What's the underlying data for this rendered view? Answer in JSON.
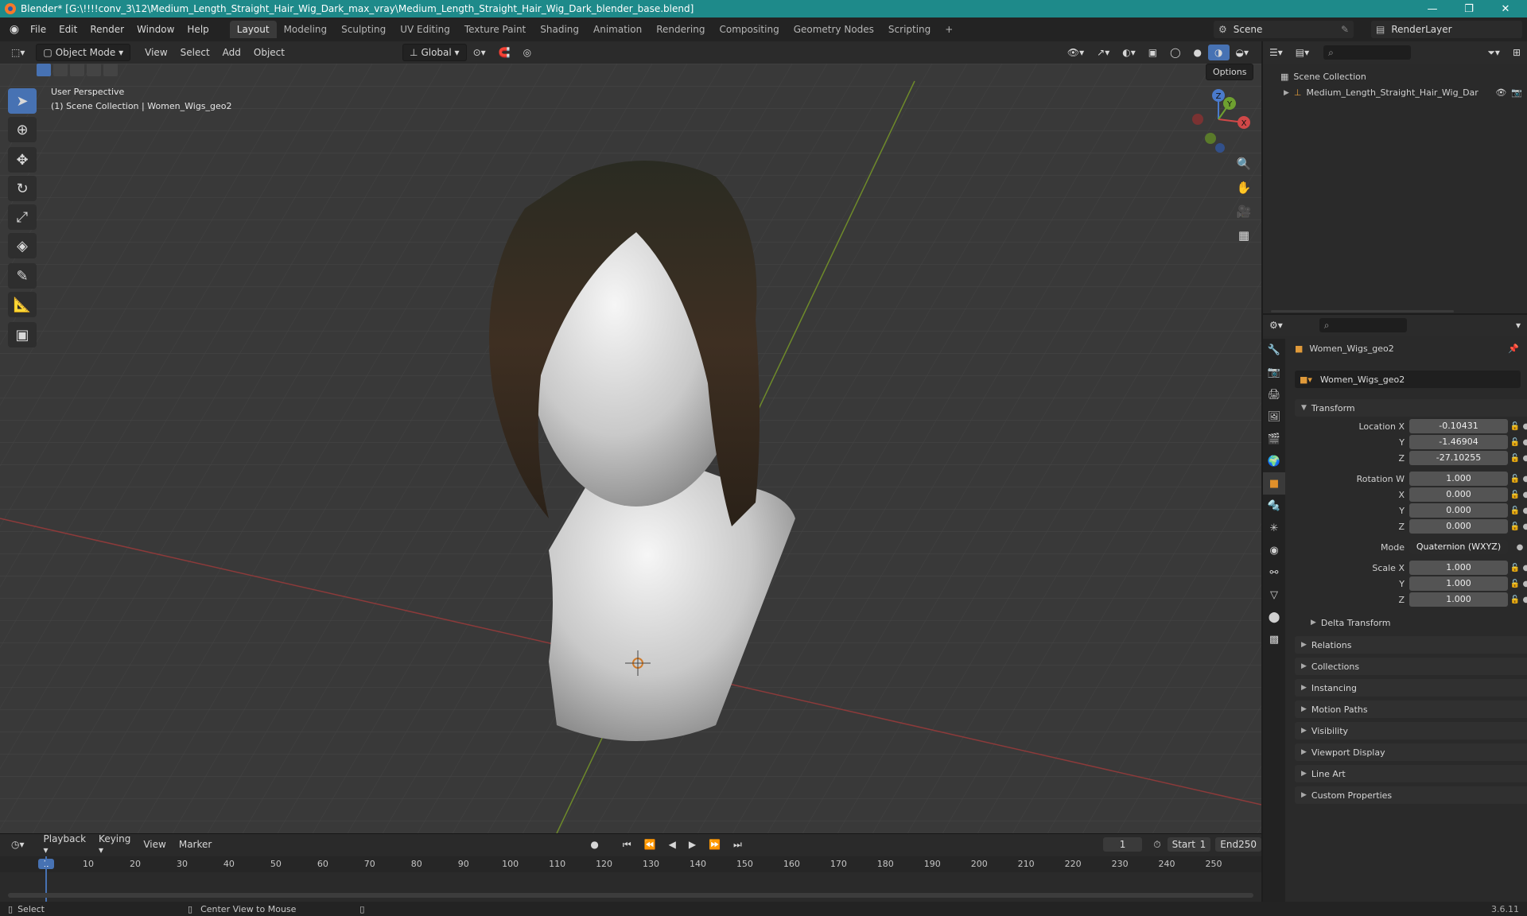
{
  "titlebar": {
    "title": "Blender* [G:\\!!!!conv_3\\12\\Medium_Length_Straight_Hair_Wig_Dark_max_vray\\Medium_Length_Straight_Hair_Wig_Dark_blender_base.blend]",
    "minimize": "—",
    "maximize": "❐",
    "close": "✕"
  },
  "menubar": {
    "menus": [
      "File",
      "Edit",
      "Render",
      "Window",
      "Help"
    ],
    "workspaces": [
      "Layout",
      "Modeling",
      "Sculpting",
      "UV Editing",
      "Texture Paint",
      "Shading",
      "Animation",
      "Rendering",
      "Compositing",
      "Geometry Nodes",
      "Scripting"
    ],
    "add_tab": "+",
    "scene": "Scene",
    "render_layer": "RenderLayer"
  },
  "viewport_header": {
    "mode": "Object Mode",
    "menus": [
      "View",
      "Select",
      "Add",
      "Object"
    ],
    "orientation": "Global",
    "options": "Options"
  },
  "viewport": {
    "perspective": "User Perspective",
    "collection_info": "(1) Scene Collection | Women_Wigs_geo2",
    "gizmo": {
      "x": "X",
      "y": "Y",
      "z": "Z"
    }
  },
  "outliner": {
    "root": "Scene Collection",
    "item": "Medium_Length_Straight_Hair_Wig_Dar"
  },
  "properties": {
    "object_name": "Women_Wigs_geo2",
    "object_field": "Women_Wigs_geo2",
    "transform_title": "Transform",
    "location": {
      "label_x": "Location X",
      "label_y": "Y",
      "label_z": "Z",
      "x": "-0.10431",
      "y": "-1.46904",
      "z": "-27.10255"
    },
    "rotation": {
      "label_w": "Rotation W",
      "label_x": "X",
      "label_y": "Y",
      "label_z": "Z",
      "w": "1.000",
      "x": "0.000",
      "y": "0.000",
      "z": "0.000"
    },
    "mode": {
      "label": "Mode",
      "value": "Quaternion (WXYZ)"
    },
    "scale": {
      "label_x": "Scale X",
      "label_y": "Y",
      "label_z": "Z",
      "x": "1.000",
      "y": "1.000",
      "z": "1.000"
    },
    "delta_transform": "Delta Transform",
    "panels": [
      "Relations",
      "Collections",
      "Instancing",
      "Motion Paths",
      "Visibility",
      "Viewport Display",
      "Line Art",
      "Custom Properties"
    ]
  },
  "timeline": {
    "menus": [
      "Playback",
      "Keying",
      "View",
      "Marker"
    ],
    "current_frame": "1",
    "start_label": "Start",
    "start": "1",
    "end_label": "End",
    "end": "250",
    "ticks": [
      "1",
      "10",
      "20",
      "30",
      "40",
      "50",
      "60",
      "70",
      "80",
      "90",
      "100",
      "110",
      "120",
      "130",
      "140",
      "150",
      "160",
      "170",
      "180",
      "190",
      "200",
      "210",
      "220",
      "230",
      "240",
      "250"
    ]
  },
  "statusbar": {
    "select": "Select",
    "center_view": "Center View to Mouse",
    "version": "3.6.11"
  }
}
